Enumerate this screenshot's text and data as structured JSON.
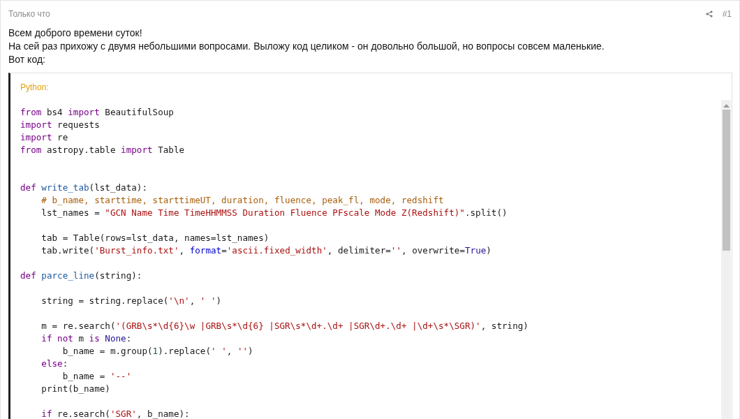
{
  "post": {
    "time": "Только что",
    "number": "#1"
  },
  "paragraphs": [
    "Всем доброго времени суток!",
    "На сей раз прихожу с двумя небольшими вопросами. Выложу код целиком - он довольно большой, но вопросы совсем маленькие.",
    "Вот код:"
  ],
  "code_block": {
    "language": "Python:",
    "groups": [
      {
        "kind": "top",
        "lines": [
          [
            {
              "text": "from",
              "kind": "keyword"
            },
            {
              "text": " bs4 ",
              "kind": "plain"
            },
            {
              "text": "import",
              "kind": "keyword"
            },
            {
              "text": " BeautifulSoup",
              "kind": "plain"
            }
          ],
          [
            {
              "text": "import",
              "kind": "keyword"
            },
            {
              "text": " requests",
              "kind": "plain"
            }
          ],
          [
            {
              "text": "import",
              "kind": "keyword"
            },
            {
              "text": " re",
              "kind": "plain"
            }
          ],
          [
            {
              "text": "from",
              "kind": "keyword"
            },
            {
              "text": " astropy.table ",
              "kind": "plain"
            },
            {
              "text": "import",
              "kind": "keyword"
            },
            {
              "text": " Table",
              "kind": "plain"
            }
          ]
        ]
      },
      {
        "kind": "wide",
        "lines": [
          [
            {
              "text": "def",
              "kind": "keyword"
            },
            {
              "text": " write_tab",
              "kind": "function"
            },
            {
              "text": "(lst_data):",
              "kind": "plain"
            }
          ],
          [
            {
              "text": "    # b_name, starttime, starttimeUT, duration, fluence, peak_fl, mode, redshift",
              "kind": "comment"
            }
          ],
          [
            {
              "text": "    lst_names = ",
              "kind": "plain"
            },
            {
              "text": "\"GCN Name Time TimeHHMMSS Duration Fluence PFscale Mode Z(Redshift)\"",
              "kind": "string"
            },
            {
              "text": ".split()",
              "kind": "plain"
            }
          ]
        ]
      },
      {
        "kind": "spaced",
        "lines": [
          [
            {
              "text": "    tab = Table(rows=lst_data, names=lst_names)",
              "kind": "plain"
            }
          ],
          [
            {
              "text": "    tab.write(",
              "kind": "plain"
            },
            {
              "text": "'Burst_info.txt'",
              "kind": "string"
            },
            {
              "text": ", ",
              "kind": "plain"
            },
            {
              "text": "format",
              "kind": "argument"
            },
            {
              "text": "=",
              "kind": "plain"
            },
            {
              "text": "'ascii.fixed_width'",
              "kind": "string"
            },
            {
              "text": ", delimiter=",
              "kind": "plain"
            },
            {
              "text": "''",
              "kind": "string"
            },
            {
              "text": ", overwrite=",
              "kind": "plain"
            },
            {
              "text": "True",
              "kind": "constant"
            },
            {
              "text": ")",
              "kind": "plain"
            }
          ]
        ]
      },
      {
        "kind": "spaced",
        "lines": [
          [
            {
              "text": "def",
              "kind": "keyword"
            },
            {
              "text": " parce_line",
              "kind": "function"
            },
            {
              "text": "(string):",
              "kind": "plain"
            }
          ]
        ]
      },
      {
        "kind": "spaced",
        "lines": [
          [
            {
              "text": "    string = string.replace(",
              "kind": "plain"
            },
            {
              "text": "'\\n'",
              "kind": "string"
            },
            {
              "text": ", ",
              "kind": "plain"
            },
            {
              "text": "' '",
              "kind": "string"
            },
            {
              "text": ")",
              "kind": "plain"
            }
          ]
        ]
      },
      {
        "kind": "spaced",
        "lines": [
          [
            {
              "text": "    m = re.search(",
              "kind": "plain"
            },
            {
              "text": "'(GRB\\s*\\d{6}\\w |GRB\\s*\\d{6} |SGR\\s*\\d+.\\d+ |SGR\\d+.\\d+ |\\d+\\s*\\SGR)'",
              "kind": "string"
            },
            {
              "text": ", string)",
              "kind": "plain"
            }
          ],
          [
            {
              "text": "    if",
              "kind": "keyword"
            },
            {
              "text": " not",
              "kind": "keyword"
            },
            {
              "text": " m ",
              "kind": "plain"
            },
            {
              "text": "is",
              "kind": "keyword"
            },
            {
              "text": " None",
              "kind": "constant"
            },
            {
              "text": ":",
              "kind": "plain"
            }
          ],
          [
            {
              "text": "        b_name = m.group(",
              "kind": "plain"
            },
            {
              "text": "1",
              "kind": "number"
            },
            {
              "text": ").replace(",
              "kind": "plain"
            },
            {
              "text": "' '",
              "kind": "string"
            },
            {
              "text": ", ",
              "kind": "plain"
            },
            {
              "text": "''",
              "kind": "string"
            },
            {
              "text": ")",
              "kind": "plain"
            }
          ],
          [
            {
              "text": "    else",
              "kind": "keyword"
            },
            {
              "text": ":",
              "kind": "plain"
            }
          ],
          [
            {
              "text": "        b_name = ",
              "kind": "plain"
            },
            {
              "text": "'--'",
              "kind": "string"
            }
          ],
          [
            {
              "text": "    print(b_name)",
              "kind": "plain"
            }
          ]
        ]
      },
      {
        "kind": "spaced",
        "lines": [
          [
            {
              "text": "    if",
              "kind": "keyword"
            },
            {
              "text": " re.search(",
              "kind": "plain"
            },
            {
              "text": "'SGR'",
              "kind": "string"
            },
            {
              "text": ", b_name):",
              "kind": "plain"
            }
          ]
        ]
      }
    ]
  }
}
